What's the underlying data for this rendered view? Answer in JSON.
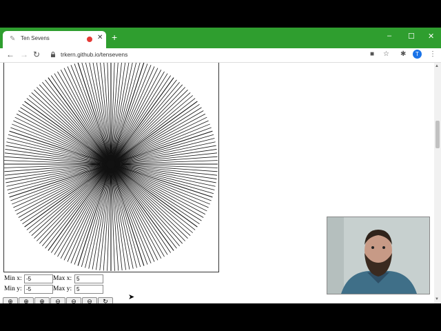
{
  "browser": {
    "tab_title": "Ten Sevens",
    "tab_close": "✕",
    "new_tab": "+",
    "url": "trkern.github.io/tensevens",
    "profile_initial": "T",
    "minimize": "–",
    "maximize": "☐",
    "close": "✕"
  },
  "controls": {
    "min_x_label": "Min x:",
    "min_x_value": "-5",
    "max_x_label": "Max x:",
    "max_x_value": "5",
    "min_y_label": "Min y:",
    "min_y_value": "-5",
    "max_y_label": "Max y:",
    "max_y_value": "5"
  },
  "toolbar": {
    "zoom_in": "⊕",
    "zoom_out": "⊖",
    "reset": "↻"
  }
}
